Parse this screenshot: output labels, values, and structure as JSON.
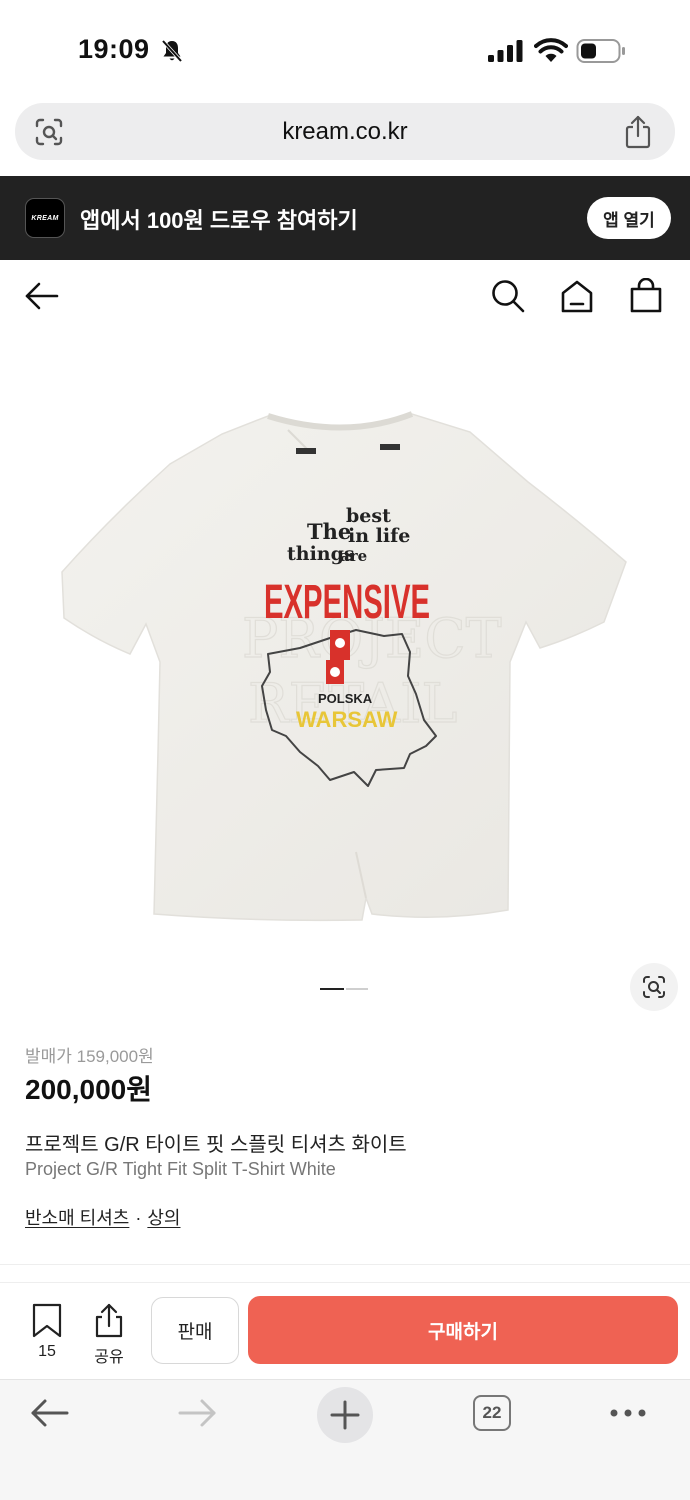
{
  "status_bar": {
    "time": "19:09"
  },
  "browser": {
    "url": "kream.co.kr",
    "tab_count": "22"
  },
  "app_banner": {
    "logo_text": "KREAM",
    "promo_text": "앱에서 100원 드로우 참여하기",
    "open_app_label": "앱 열기"
  },
  "product": {
    "release_price": "발매가 159,000원",
    "price": "200,000원",
    "name_ko": "프로젝트 G/R 타이트 핏 스플릿 티셔츠 화이트",
    "name_en": "Project G/R Tight Fit Split T-Shirt White",
    "categories": [
      "반소매 티셔츠",
      "상의"
    ],
    "category_separator": "·",
    "image": {
      "print_text": [
        "The",
        "best",
        "in life",
        "things",
        "are",
        "EXPENSIVE",
        "POLSKA",
        "WARSAW"
      ],
      "carousel_pages": 2,
      "carousel_active": 1
    }
  },
  "action_bar": {
    "wish_count": "15",
    "share_label": "공유",
    "sell_label": "판매",
    "buy_label": "구매하기"
  },
  "colors": {
    "buy_button": "#ef6253",
    "banner_bg": "#222222",
    "print_red": "#d8312b",
    "print_yellow": "#e8c638"
  }
}
